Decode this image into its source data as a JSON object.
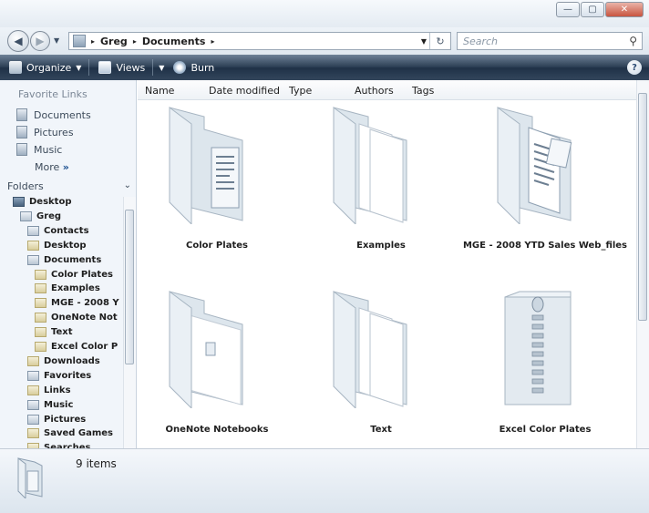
{
  "window": {
    "minimize_glyph": "—",
    "maximize_glyph": "▢",
    "close_glyph": "✕"
  },
  "address": {
    "crumbs": [
      "Greg",
      "Documents"
    ],
    "separator": "▸",
    "refresh_glyph": "↻",
    "search_placeholder": "Search"
  },
  "toolbar": {
    "items": [
      {
        "label": "Organize",
        "icon": "organize-icon"
      },
      {
        "label": "Views",
        "icon": "views-icon"
      },
      {
        "label": "Burn",
        "icon": "burn-icon"
      }
    ],
    "help_glyph": "?"
  },
  "nav": {
    "favorites_title": "Favorite Links",
    "favorites": [
      "Documents",
      "Pictures",
      "Music"
    ],
    "more_label": "More",
    "more_glyph": "»",
    "folders_title": "Folders",
    "tree": [
      {
        "label": "Desktop",
        "indent": 0,
        "kind": "desk"
      },
      {
        "label": "Greg",
        "indent": 1,
        "kind": "docf"
      },
      {
        "label": "Contacts",
        "indent": 2,
        "kind": "docf"
      },
      {
        "label": "Desktop",
        "indent": 2,
        "kind": "fold"
      },
      {
        "label": "Documents",
        "indent": 2,
        "kind": "docf"
      },
      {
        "label": "Color Plates",
        "indent": 3,
        "kind": "fold"
      },
      {
        "label": "Examples",
        "indent": 3,
        "kind": "fold"
      },
      {
        "label": "MGE - 2008 Y",
        "indent": 3,
        "kind": "fold"
      },
      {
        "label": "OneNote Not",
        "indent": 3,
        "kind": "fold"
      },
      {
        "label": "Text",
        "indent": 3,
        "kind": "fold"
      },
      {
        "label": "Excel Color P",
        "indent": 3,
        "kind": "fold"
      },
      {
        "label": "Downloads",
        "indent": 2,
        "kind": "fold"
      },
      {
        "label": "Favorites",
        "indent": 2,
        "kind": "docf"
      },
      {
        "label": "Links",
        "indent": 2,
        "kind": "fold"
      },
      {
        "label": "Music",
        "indent": 2,
        "kind": "docf"
      },
      {
        "label": "Pictures",
        "indent": 2,
        "kind": "docf"
      },
      {
        "label": "Saved Games",
        "indent": 2,
        "kind": "fold"
      },
      {
        "label": "Searches",
        "indent": 2,
        "kind": "fold"
      }
    ]
  },
  "columns": [
    "Name",
    "Date modified",
    "Type",
    "Authors",
    "Tags"
  ],
  "items": [
    {
      "label": "Color Plates",
      "icon": "folder-with-document-icon"
    },
    {
      "label": "Examples",
      "icon": "folder-with-pages-icon"
    },
    {
      "label": "MGE - 2008 YTD Sales Web_files",
      "icon": "folder-with-web-files-icon"
    },
    {
      "label": "OneNote Notebooks",
      "icon": "folder-icon"
    },
    {
      "label": "Text",
      "icon": "folder-with-pages-icon"
    },
    {
      "label": "Excel Color Plates",
      "icon": "zipped-folder-icon"
    }
  ],
  "details": {
    "count": "9 items"
  }
}
